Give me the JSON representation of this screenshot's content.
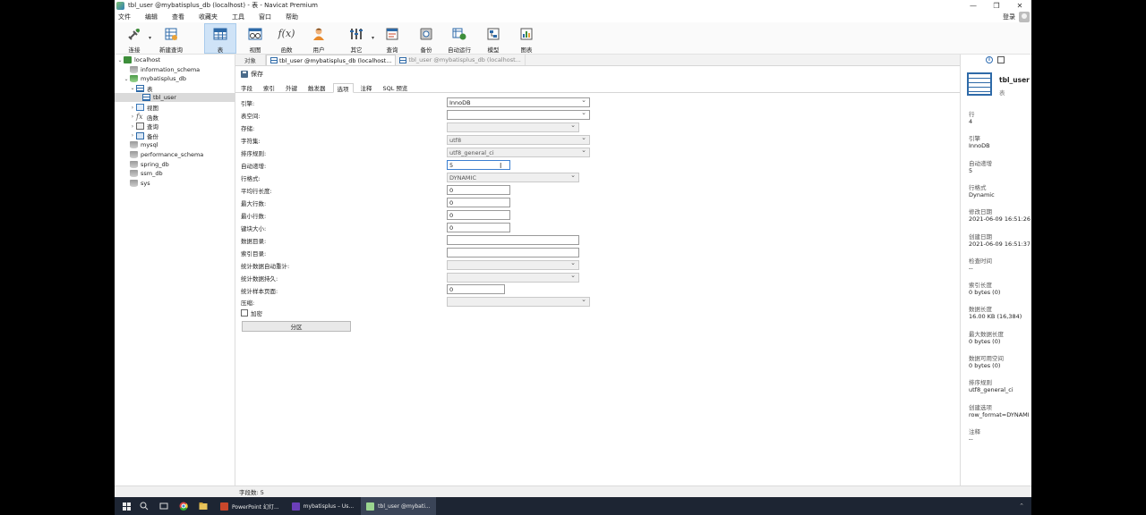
{
  "window": {
    "title": "tbl_user @mybatisplus_db (localhost) - 表 - Navicat Premium"
  },
  "menu": [
    "文件",
    "编辑",
    "查看",
    "收藏夹",
    "工具",
    "窗口",
    "帮助"
  ],
  "login_label": "登录",
  "toolbar": [
    {
      "label": "连接",
      "icon": "connection-icon"
    },
    {
      "label": "新建查询",
      "icon": "new-query-icon"
    },
    {
      "label": "表",
      "icon": "table-icon",
      "active": true
    },
    {
      "label": "视图",
      "icon": "view-icon"
    },
    {
      "label": "函数",
      "icon": "function-icon"
    },
    {
      "label": "用户",
      "icon": "user-icon"
    },
    {
      "label": "其它",
      "icon": "tools-icon"
    },
    {
      "label": "查询",
      "icon": "query-icon"
    },
    {
      "label": "备份",
      "icon": "backup-icon"
    },
    {
      "label": "自动运行",
      "icon": "schedule-icon"
    },
    {
      "label": "模型",
      "icon": "model-icon"
    },
    {
      "label": "图表",
      "icon": "chart-icon"
    }
  ],
  "tree": [
    {
      "label": "localhost",
      "level": 0,
      "expander": "⌄",
      "icon": "connection"
    },
    {
      "label": "information_schema",
      "level": 1,
      "icon": "db"
    },
    {
      "label": "mybatisplus_db",
      "level": 1,
      "expander": "⌄",
      "icon": "db-green"
    },
    {
      "label": "表",
      "level": 2,
      "expander": "⌄",
      "icon": "table"
    },
    {
      "label": "tbl_user",
      "level": 3,
      "icon": "table",
      "selected": true
    },
    {
      "label": "视图",
      "level": 2,
      "expander": "›",
      "icon": "view"
    },
    {
      "label": "函数",
      "level": 2,
      "expander": "›",
      "icon": "fx"
    },
    {
      "label": "查询",
      "level": 2,
      "expander": "›",
      "icon": "query"
    },
    {
      "label": "备份",
      "level": 2,
      "expander": "›",
      "icon": "backup"
    },
    {
      "label": "mysql",
      "level": 1,
      "icon": "db"
    },
    {
      "label": "performance_schema",
      "level": 1,
      "icon": "db"
    },
    {
      "label": "spring_db",
      "level": 1,
      "icon": "db"
    },
    {
      "label": "ssm_db",
      "level": 1,
      "icon": "db"
    },
    {
      "label": "sys",
      "level": 1,
      "icon": "db"
    }
  ],
  "object_tabs": [
    {
      "label": "对象"
    },
    {
      "label": "tbl_user @mybatisplus_db (localhost...",
      "active": true
    },
    {
      "label": "tbl_user @mybatisplus_db (localhost...",
      "dim": true
    }
  ],
  "save_label": "保存",
  "sub_tabs": [
    "字段",
    "索引",
    "外键",
    "触发器",
    "选项",
    "注释",
    "SQL 预览"
  ],
  "active_sub_tab": 4,
  "options": {
    "engine": {
      "label": "引擎:",
      "value": "InnoDB"
    },
    "tablespace": {
      "label": "表空间:",
      "value": ""
    },
    "storage": {
      "label": "存储:",
      "value": ""
    },
    "charset": {
      "label": "字符集:",
      "value": "utf8"
    },
    "collation": {
      "label": "排序规则:",
      "value": "utf8_general_ci"
    },
    "auto_increment": {
      "label": "自动递增:",
      "value": "5"
    },
    "row_format": {
      "label": "行格式:",
      "value": "DYNAMIC"
    },
    "avg_row_length": {
      "label": "平均行长度:",
      "value": "0"
    },
    "max_rows": {
      "label": "最大行数:",
      "value": "0"
    },
    "min_rows": {
      "label": "最小行数:",
      "value": "0"
    },
    "key_block_size": {
      "label": "键块大小:",
      "value": "0"
    },
    "data_directory": {
      "label": "数据目录:",
      "value": ""
    },
    "index_directory": {
      "label": "索引目录:",
      "value": ""
    },
    "stats_auto_recalc": {
      "label": "统计数据自动重计:",
      "value": ""
    },
    "stats_persistent": {
      "label": "统计数据持久:",
      "value": ""
    },
    "stats_sample_pages": {
      "label": "统计样本页面:",
      "value": "0"
    },
    "compression": {
      "label": "压缩:",
      "value": ""
    },
    "encryption": {
      "label": "加密"
    }
  },
  "partition_button": "分区",
  "status": {
    "field_count": "字段数: 5"
  },
  "info": {
    "name": "tbl_user",
    "type": "表",
    "items": [
      {
        "key": "行",
        "value": "4"
      },
      {
        "key": "引擎",
        "value": "InnoDB"
      },
      {
        "key": "自动递增",
        "value": "5"
      },
      {
        "key": "行格式",
        "value": "Dynamic"
      },
      {
        "key": "修改日期",
        "value": "2021-06-09 16:51:26"
      },
      {
        "key": "创建日期",
        "value": "2021-06-09 16:51:37"
      },
      {
        "key": "检查时间",
        "value": "--"
      },
      {
        "key": "索引长度",
        "value": "0 bytes (0)"
      },
      {
        "key": "数据长度",
        "value": "16.00 KB (16,384)"
      },
      {
        "key": "最大数据长度",
        "value": "0 bytes (0)"
      },
      {
        "key": "数据可用空间",
        "value": "0 bytes (0)"
      },
      {
        "key": "排序规则",
        "value": "utf8_general_ci"
      },
      {
        "key": "创建选项",
        "value": "row_format=DYNAMI"
      },
      {
        "key": "注释",
        "value": "--"
      }
    ]
  },
  "taskbar": [
    {
      "label": "PowerPoint 幻灯...",
      "color": "#c9472b"
    },
    {
      "label": "mybatisplus – Us...",
      "color": "#6b3fb8"
    },
    {
      "label": "tbl_user @mybati...",
      "color": "#9ad58f",
      "active": true
    }
  ]
}
